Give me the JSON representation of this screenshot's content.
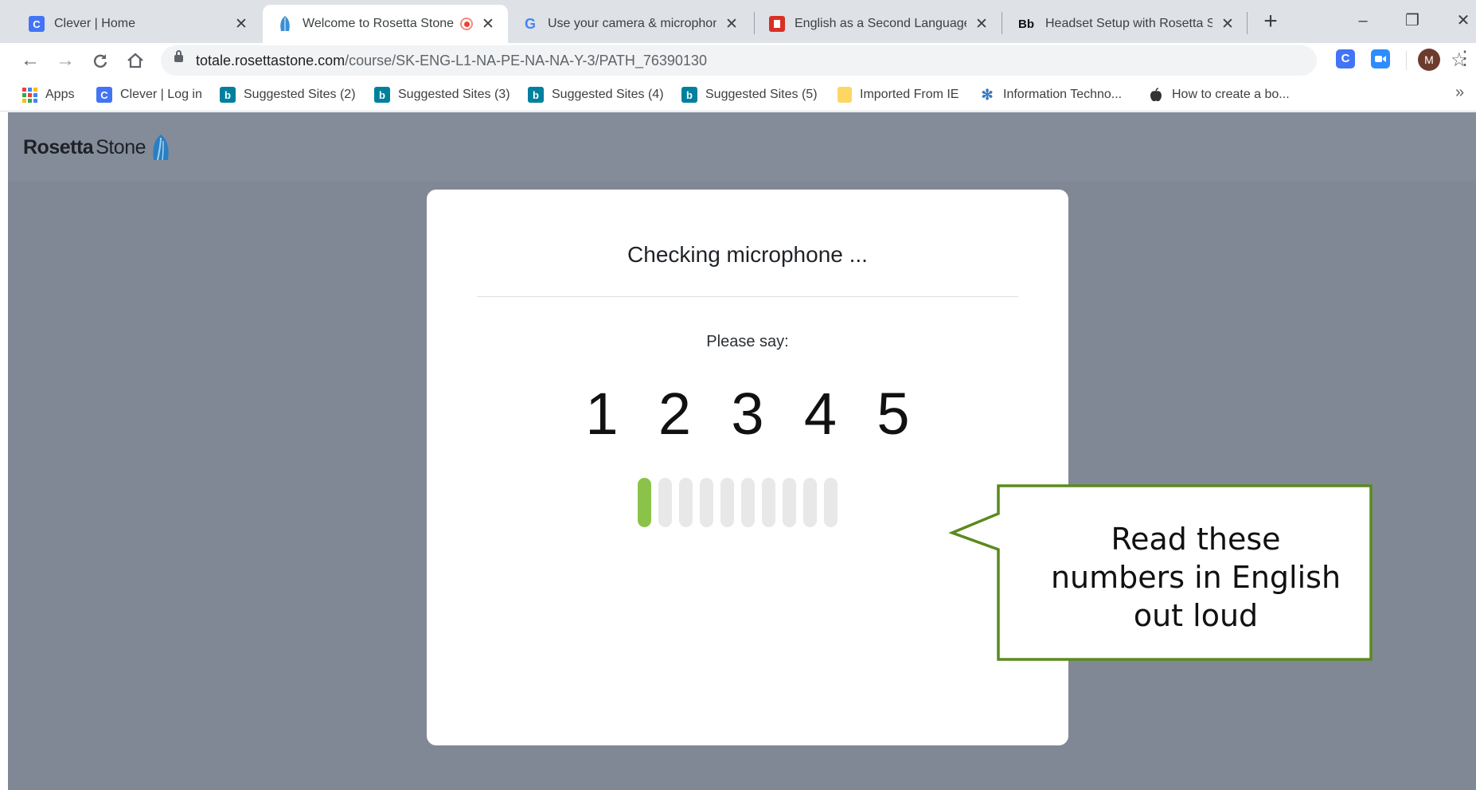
{
  "browser": {
    "tabs": [
      {
        "title": "Clever | Home",
        "favicon": "clever-icon",
        "color": "#4274f6"
      },
      {
        "title": "Welcome to Rosetta Stone",
        "favicon": "rosetta-stone-icon",
        "active": true,
        "recording": true
      },
      {
        "title": "Use your camera & microphone",
        "favicon": "google-icon"
      },
      {
        "title": "English as a Second Language",
        "favicon": "esl-icon",
        "color": "#d93025"
      },
      {
        "title": "Headset Setup with Rosetta Stone",
        "favicon": "blackboard-icon",
        "favicon_text": "Bb"
      }
    ],
    "new_tab_label": "+",
    "window_controls": {
      "minimize": "–",
      "restore": "❐",
      "close": "✕"
    },
    "url": {
      "host": "totale.rosettastone.com",
      "path": "/course/SK-ENG-L1-NA-PE-NA-NA-Y-3/PATH_76390130"
    },
    "profile_initial": "M",
    "bookmarks": [
      {
        "label": "Apps",
        "icon": "apps-grid-icon"
      },
      {
        "label": "Clever | Log in",
        "icon": "clever-icon",
        "color": "#4274f6"
      },
      {
        "label": "Suggested Sites (2)",
        "icon": "bing-icon",
        "color": "#00809d"
      },
      {
        "label": "Suggested Sites (3)",
        "icon": "bing-icon",
        "color": "#00809d"
      },
      {
        "label": "Suggested Sites (4)",
        "icon": "bing-icon",
        "color": "#00809d"
      },
      {
        "label": "Suggested Sites (5)",
        "icon": "bing-icon",
        "color": "#00809d"
      },
      {
        "label": "Imported From IE",
        "icon": "folder-icon",
        "color": "#fdd663"
      },
      {
        "label": "Information Techno...",
        "icon": "info-tech-icon"
      },
      {
        "label": "How to create a bo...",
        "icon": "apple-icon"
      }
    ],
    "bookmarks_overflow": "»"
  },
  "app": {
    "logo_bold": "Rosetta",
    "logo_light": "Stone"
  },
  "dialog": {
    "title": "Checking microphone ...",
    "instruction": "Please say:",
    "digits": [
      "1",
      "2",
      "3",
      "4",
      "5"
    ],
    "meter": {
      "bars": 10,
      "active_bars": 1,
      "active_color": "#8bc34a"
    }
  },
  "callout": {
    "lines": [
      "Read these",
      "numbers in English",
      "out loud"
    ],
    "border_color": "#5a8a1e"
  }
}
